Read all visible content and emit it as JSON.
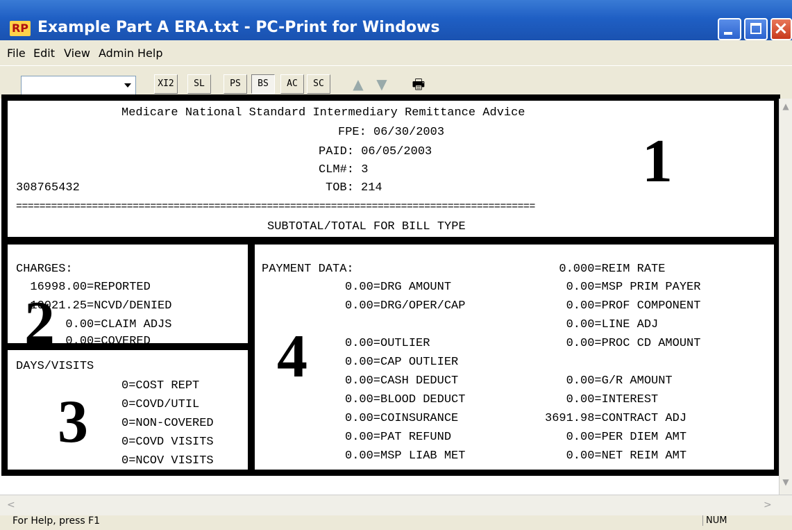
{
  "window": {
    "app_icon": "RP",
    "title": "Example Part A ERA.txt - PC-Print for Windows",
    "controls": {
      "minimize": "minimize-icon",
      "maximize": "maximize-icon",
      "close": "×"
    }
  },
  "menu": [
    "File",
    "Edit",
    "View",
    "Admin",
    "Help"
  ],
  "toolbar": {
    "combo_value": "",
    "buttons": [
      "XI2",
      "SL",
      "PS",
      "BS",
      "AC",
      "SC"
    ],
    "pressed": "BS",
    "up_arrow": "▲",
    "down_arrow": "▼",
    "print_icon": "🖶"
  },
  "header": {
    "title": "Medicare National Standard Intermediary Remittance Advice",
    "fpe": "FPE: 06/30/2003",
    "paid": "PAID: 06/05/2003",
    "clm": "CLM#: 3",
    "id": "308765432",
    "tob": "TOB: 214",
    "rule": "=========================================================================================",
    "subtotal": "SUBTOTAL/TOTAL FOR BILL TYPE",
    "label_number": "1"
  },
  "charges": {
    "heading": "CHARGES:",
    "label_number": "2",
    "lines": [
      "  16998.00=REPORTED",
      "  10021.25=NCVD/DENIED",
      "       0.00=CLAIM ADJS",
      "       0.00=COVERED"
    ]
  },
  "days": {
    "heading": "DAYS/VISITS",
    "label_number": "3",
    "lines": [
      "0=COST REPT",
      "0=COVD/UTIL",
      "0=NON-COVERED",
      "0=COVD VISITS",
      "0=NCOV VISITS"
    ]
  },
  "payment": {
    "heading": "PAYMENT DATA:",
    "label_number": "4",
    "left_lines": [
      "0.00=DRG AMOUNT",
      "0.00=DRG/OPER/CAP",
      "",
      "0.00=OUTLIER",
      "0.00=CAP OUTLIER",
      "0.00=CASH DEDUCT",
      "0.00=BLOOD DEDUCT",
      "0.00=COINSURANCE",
      "0.00=PAT REFUND",
      "0.00=MSP LIAB MET"
    ],
    "right_lines": [
      "  0.000=REIM RATE",
      "   0.00=MSP PRIM PAYER",
      "   0.00=PROF COMPONENT",
      "   0.00=LINE ADJ",
      "   0.00=PROC CD AMOUNT",
      "",
      "   0.00=G/R AMOUNT",
      "   0.00=INTEREST",
      "3691.98=CONTRACT ADJ",
      "   0.00=PER DIEM AMT",
      "   0.00=NET REIM AMT"
    ]
  },
  "scroll": {
    "up": "▲",
    "down": "▼",
    "left": "<",
    "right": ">"
  },
  "status": {
    "help": "For Help, press F1",
    "num": "NUM"
  }
}
